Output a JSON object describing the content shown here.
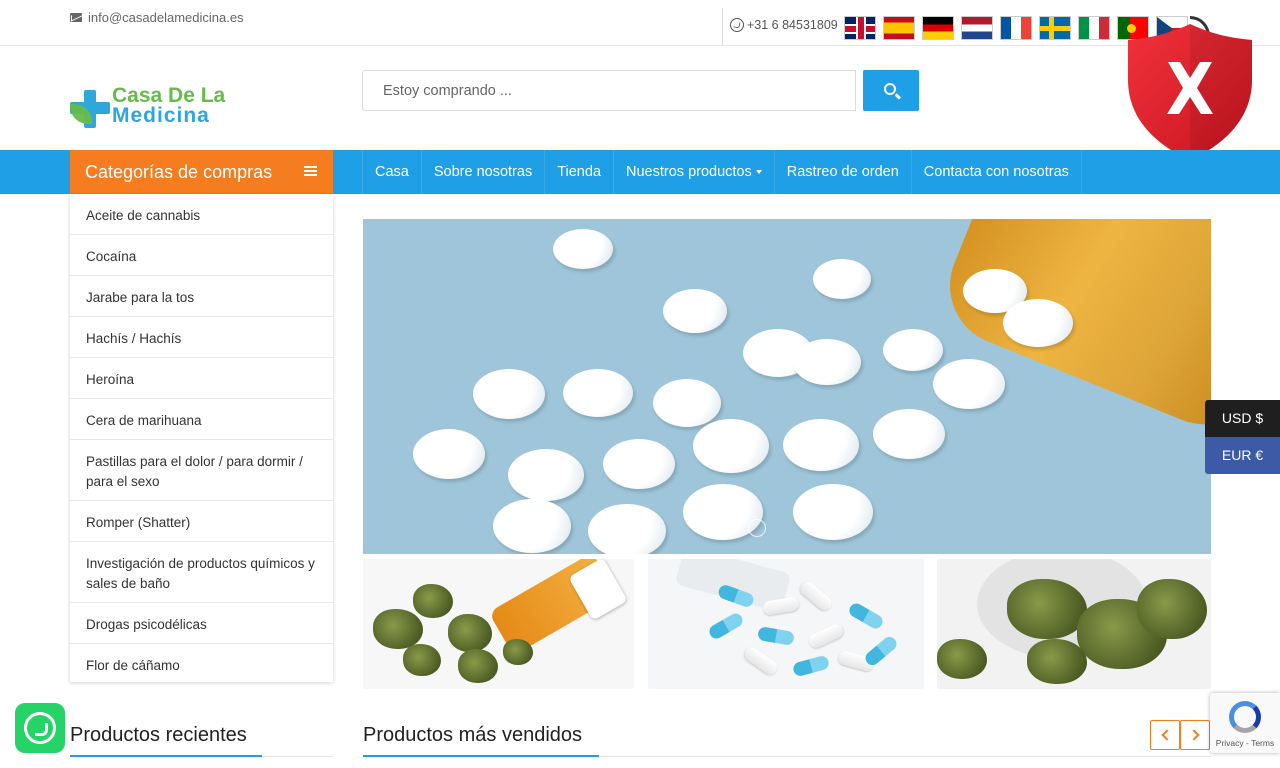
{
  "topbar": {
    "email": "info@casadelamedicina.es",
    "phone": "+31 6 84531809",
    "languages": [
      "English",
      "Español",
      "Deutsch",
      "Nederlands",
      "Français",
      "Svenska",
      "Italiano",
      "Português",
      "Čeština"
    ]
  },
  "header": {
    "logo_line1": "Casa De La",
    "logo_line2": "Medicina",
    "search_placeholder": "Estoy comprando ..."
  },
  "nav": {
    "categories_title": "Categorías de compras",
    "menu": [
      "Casa",
      "Sobre nosotras",
      "Tienda",
      "Nuestros productos",
      "Rastreo de orden",
      "Contacta con nosotras"
    ]
  },
  "sidebar": {
    "items": [
      "Aceite de cannabis",
      "Cocaína",
      "Jarabe para la tos",
      "Hachís / Hachís",
      "Heroína",
      "Cera de marihuana",
      "Pastillas para el dolor / para dormir / para el sexo",
      "Romper (Shatter)",
      "Investigación de productos químicos y sales de baño",
      "Drogas psicodélicas",
      "Flor de cáñamo"
    ]
  },
  "currency": {
    "usd": "USD $",
    "eur": "EUR €"
  },
  "sections": {
    "recent": "Productos recientes",
    "bestsellers": "Productos más vendidos"
  },
  "recaptcha": {
    "links": "Privacy - Terms"
  },
  "colors": {
    "primary_blue": "#1e9fe6",
    "accent_orange": "#f57d1f",
    "shield_red": "#e2202c",
    "whatsapp_green": "#25d366"
  }
}
